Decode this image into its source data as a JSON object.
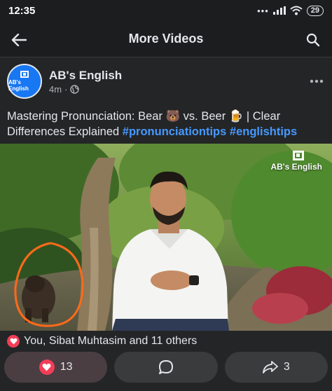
{
  "status_bar": {
    "time": "12:35",
    "battery": "29"
  },
  "top_bar": {
    "title": "More Videos"
  },
  "post": {
    "avatar_text": "AB's English",
    "page_name": "AB's English",
    "time": "4m",
    "separator": "·",
    "caption_text": "Mastering Pronunciation: Bear 🐻 vs. Beer 🍺 | Clear Differences Explained ",
    "hashtags": [
      "#pronunciationtips",
      "#englishtips"
    ],
    "video_brand": "AB's English",
    "reactions_text": "You, Sibat Muhtasim and 11 others"
  },
  "actions": {
    "like_count": "13",
    "share_count": "3"
  },
  "colors": {
    "background": "#242526",
    "bar": "#1c1d1e",
    "hashtag": "#4599ff",
    "love": "#f33e58",
    "button": "#3a3b3c",
    "annotation": "#ff6a1a"
  },
  "icons": [
    "back-arrow-icon",
    "search-icon",
    "more-dots-icon",
    "globe-icon",
    "heart-icon",
    "comment-icon",
    "share-icon",
    "wifi-icon"
  ]
}
